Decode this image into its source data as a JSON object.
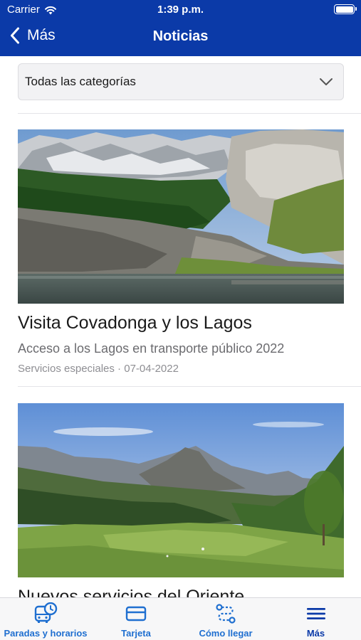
{
  "status_bar": {
    "carrier": "Carrier",
    "time": "1:39 p.m.",
    "icons": [
      "wifi-icon",
      "battery-icon"
    ]
  },
  "nav": {
    "back_label": "Más",
    "title": "Noticias"
  },
  "filter": {
    "selected": "Todas las categorías",
    "icon": "chevron-down-icon"
  },
  "news": [
    {
      "title": "Visita Covadonga y los Lagos",
      "subtitle": "Acceso a los Lagos en transporte público 2022",
      "category": "Servicios especiales",
      "date": "07-04-2022",
      "meta": "Servicios especiales · 07-04-2022",
      "image": "mountain-lake-photo"
    },
    {
      "title": "Nuevos servicios del Oriente",
      "image": "green-valley-mountains-photo"
    }
  ],
  "tabbar": {
    "tabs": [
      {
        "label": "Paradas y horarios",
        "icon": "bus-clock-icon"
      },
      {
        "label": "Tarjeta",
        "icon": "card-icon"
      },
      {
        "label": "Cómo llegar",
        "icon": "route-icon"
      },
      {
        "label": "Más",
        "icon": "menu-icon",
        "active": true
      }
    ]
  },
  "colors": {
    "header": "#0b3aa8",
    "tab_label": "#1f6fd0",
    "tab_active": "#0b3aa8"
  }
}
